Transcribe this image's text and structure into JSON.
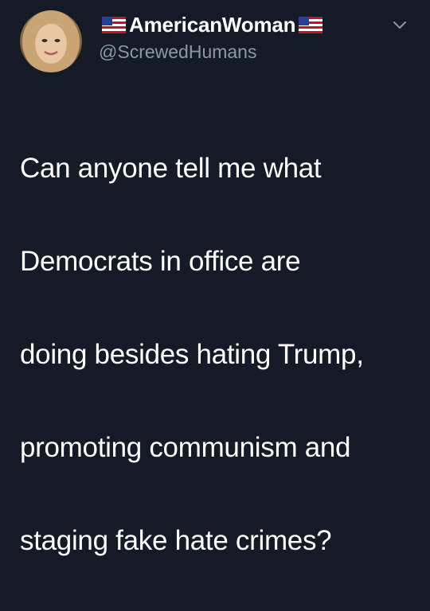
{
  "tweet": {
    "display_name": "AmericanWoman",
    "handle": "@ScrewedHumans",
    "text_lines": [
      "Can anyone tell me what",
      "Democrats in office are",
      "doing besides hating Trump,",
      "promoting communism and",
      "staging fake hate crimes?"
    ],
    "icons": {
      "name_prefix": "us-flag-icon",
      "name_suffix": "us-flag-icon",
      "menu": "chevron-down-icon"
    }
  },
  "colors": {
    "background": "#141b26",
    "text": "#ffffff",
    "handle": "#8b98a6"
  }
}
